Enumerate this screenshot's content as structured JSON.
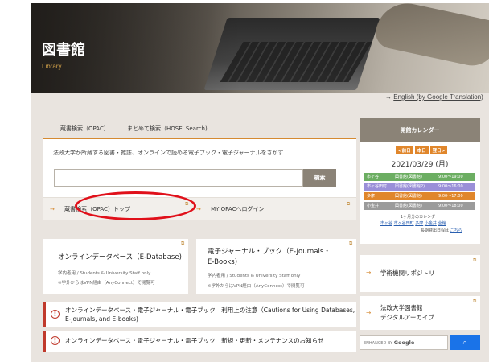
{
  "hero": {
    "title": "図書館",
    "subtitle": "Library"
  },
  "language_link": {
    "arrow": "→",
    "label": "English (by Google Translation)"
  },
  "search": {
    "tabs": [
      {
        "label": "蔵書検索（OPAC）",
        "active": true
      },
      {
        "label": "まとめて検索（HOSEI Search)",
        "active": false
      }
    ],
    "description": "法政大学が所蔵する図書・雑誌、オンラインで読める電子ブック・電子ジャーナルをさがす",
    "input_value": "",
    "button_label": "検索",
    "links": [
      {
        "arrow": "→",
        "label": "蔵書検索（OPAC）トップ",
        "ext_icon": "external-link-icon"
      },
      {
        "arrow": "→",
        "label": "MY OPACへログイン",
        "ext_icon": "external-link-icon"
      }
    ]
  },
  "databases": [
    {
      "title": "オンラインデータベース（E-Database)",
      "note1": "学内者用 / Students & University Staff only",
      "note2": "※学外からはVPN経由（AnyConnect）で閲覧可"
    },
    {
      "title_line1": "電子ジャーナル・ブック（E-Journals・",
      "title_line2": "E-Books)",
      "note1": "学内者用 / Students & University Staff only",
      "note2": "※学外からはVPN経由（AnyConnect）で閲覧可"
    }
  ],
  "notices": [
    {
      "icon": "!",
      "line1": "オンラインデータベース・電子ジャーナル・電子ブック　利用上の注意（Cautions for Using Databases,",
      "line2": "E-journals, and E-books)"
    },
    {
      "icon": "!",
      "line1": "オンラインデータベース・電子ジャーナル・電子ブック　新規・更新・メンテナンスのお知らせ"
    }
  ],
  "calendar": {
    "header": "開館カレンダー",
    "nav": [
      "<前日",
      "本日",
      "翌日>"
    ],
    "date": "2021/03/29 (月)",
    "rows": [
      {
        "campus": "市ヶ谷",
        "room": "図書館(図書館)",
        "hours": "9:00～19:00",
        "color": "#6cae62"
      },
      {
        "campus": "市ヶ谷田町",
        "room": "図書館(図書館2)",
        "hours": "9:00～16:00",
        "color": "#9a8fd8"
      },
      {
        "campus": "多摩",
        "room": "図書館(図書館)",
        "hours": "9:00～17:00",
        "color": "#e0862b"
      },
      {
        "campus": "小金井",
        "room": "図書館(図書館)",
        "hours": "9:00～18:00",
        "color": "#9b9b9b"
      }
    ],
    "month_label": "1ヶ月分のカレンダー",
    "month_links": [
      "市ヶ谷",
      "市ヶ谷田町",
      "多摩",
      "小金井",
      "全館"
    ],
    "hours_note": "長期貸出日程は",
    "hours_link": "こちら"
  },
  "side_links": [
    {
      "arrow": "→",
      "line1": "学術機関リポジトリ",
      "line2": ""
    },
    {
      "arrow": "→",
      "line1": "法政大学図書館",
      "line2": "デジタルアーカイブ"
    }
  ],
  "google_search": {
    "enhanced_by": "ENHANCED BY",
    "brand": "Google",
    "button_icon": "search-icon"
  }
}
